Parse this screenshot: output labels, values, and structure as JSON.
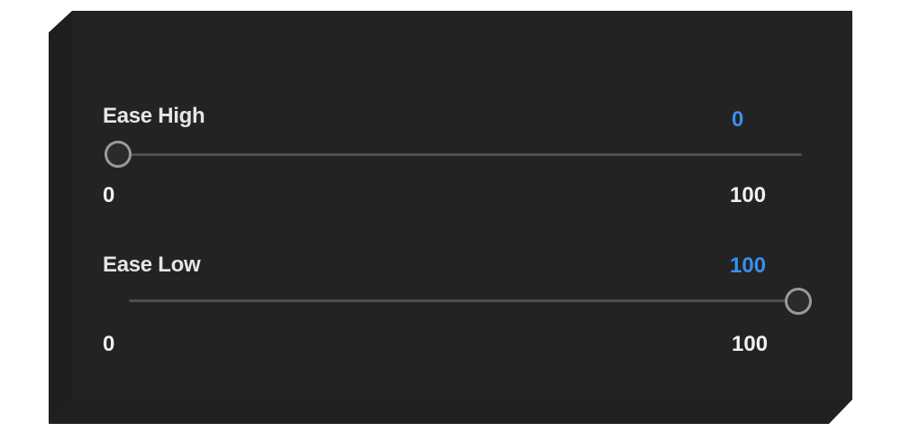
{
  "sliders": [
    {
      "label": "Ease High",
      "value": 0,
      "value_text": "0",
      "min_label": "0",
      "max_label": "100"
    },
    {
      "label": "Ease Low",
      "value": 100,
      "value_text": "100",
      "min_label": "0",
      "max_label": "100"
    }
  ],
  "colors": {
    "panel": "#232323",
    "accent_value": "#3a8ef0",
    "track": "#4e4e4e",
    "thumb_border": "#9a9a9a",
    "label": "#e6e6e6"
  }
}
